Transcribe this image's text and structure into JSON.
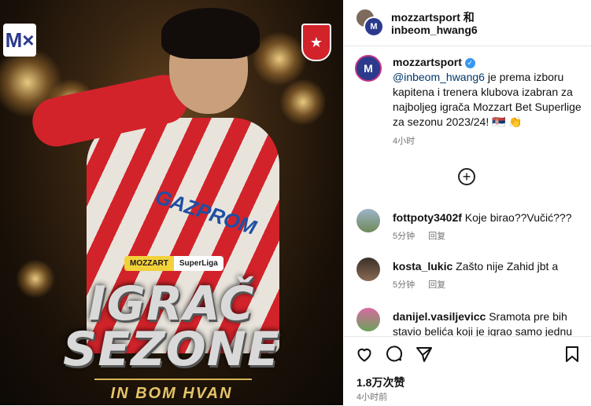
{
  "image": {
    "logo_text": "M×",
    "crest_text": "★",
    "badge_mozzart": "MOZZART",
    "badge_superliga": "SuperLiga",
    "sponsor": "GAZPROM",
    "headline_line1": "IGRAČ",
    "headline_line2": "SEZONE",
    "player_name": "IN BOM HVAN"
  },
  "header": {
    "line1": "mozzartsport 和",
    "line2": "inbeom_hwang6"
  },
  "caption": {
    "username": "mozzartsport",
    "mention": "@inbeom_hwang6",
    "text": " je prema izboru kapitena i trenera klubova izabran za najboljeg igrača Mozzart Bet Superlige za sezonu 2023/24! 🇷🇸 👏",
    "time": "4小时"
  },
  "comments": [
    {
      "username": "fottpoty3402f",
      "text": "Koje birao??Vučić???",
      "time": "5分钟",
      "reply": "回复"
    },
    {
      "username": "kosta_lukic",
      "text": "Zašto nije Zahid jbt a",
      "time": "5分钟",
      "reply": "回复"
    },
    {
      "username": "danijel.vasiljevicc",
      "text": "Sramota pre bih stavio belića koji je igrao samo jednu",
      "time": "",
      "reply": ""
    }
  ],
  "footer": {
    "likes": "1.8万次赞",
    "time": "4小时前"
  },
  "colors": {
    "verified": "#3897f0",
    "mention": "#00376b",
    "club_red": "#d2232a"
  }
}
